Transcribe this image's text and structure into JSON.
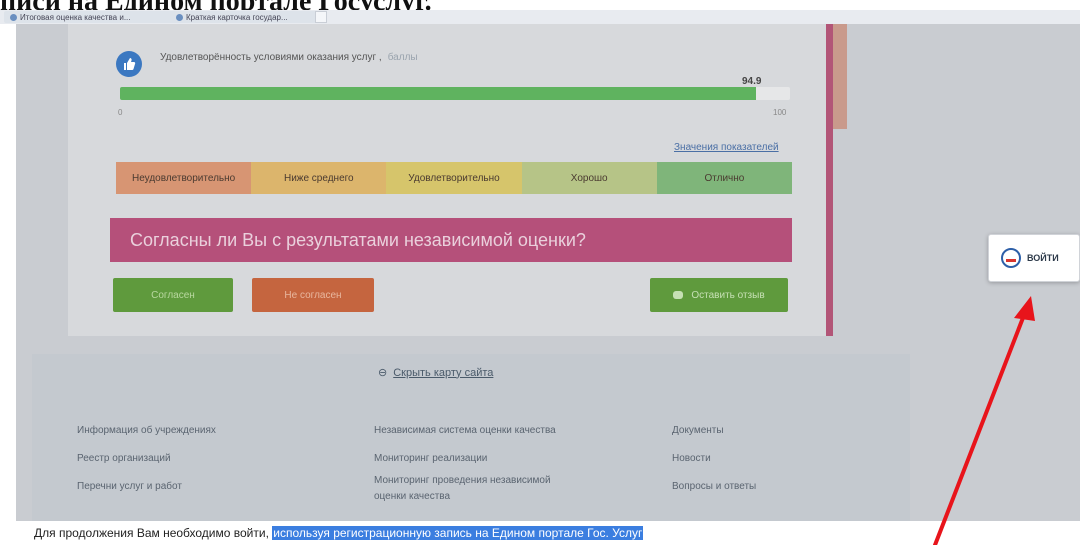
{
  "top_caption": "писи на Едином портале Госуслуг.",
  "browser": {
    "tabs": [
      {
        "label": "Итоговая оценка качества и..."
      },
      {
        "label": "Краткая карточка государ..."
      }
    ]
  },
  "card": {
    "satisfaction_label": "Удовлетворённость условиями оказания услуг ,",
    "satisfaction_sub": "баллы",
    "score": "94.9",
    "score_fraction": 0.949,
    "tick_min": "0",
    "tick_max": "100",
    "values_link": "Значения показателей",
    "scale": [
      {
        "label": "Неудовлетворительно",
        "color": "#d79573"
      },
      {
        "label": "Ниже среднего",
        "color": "#dcb56c"
      },
      {
        "label": "Удовлетворительно",
        "color": "#d6c56b"
      },
      {
        "label": "Хорошо",
        "color": "#b6c487"
      },
      {
        "label": "Отлично",
        "color": "#7fb57a"
      }
    ],
    "banner": "Согласны ли Вы с результатами независимой оценки?",
    "agree_button": "Согласен",
    "disagree_button": "Не согласен",
    "review_button": "Оставить отзыв"
  },
  "footer": {
    "hide_map": "Скрыть карту сайта",
    "col1": [
      "Информация об учреждениях",
      "Реестр организаций",
      "Перечни услуг и работ"
    ],
    "col2": [
      "Независимая система оценки качества",
      "Мониторинг реализации",
      "Мониторинг проведения независимой",
      "оценки качества"
    ],
    "col3": [
      "Документы",
      "Новости",
      "Вопросы и ответы"
    ]
  },
  "login": {
    "label": "ВОЙТИ"
  },
  "bottom_text": {
    "plain": "Для продолжения Вам необходимо войти, ",
    "highlighted": "используя регистрационную запись на Едином портале Гос. Услуг"
  },
  "colors": {
    "arrow": "#e8141b",
    "highlight": "#3b7ee0"
  }
}
